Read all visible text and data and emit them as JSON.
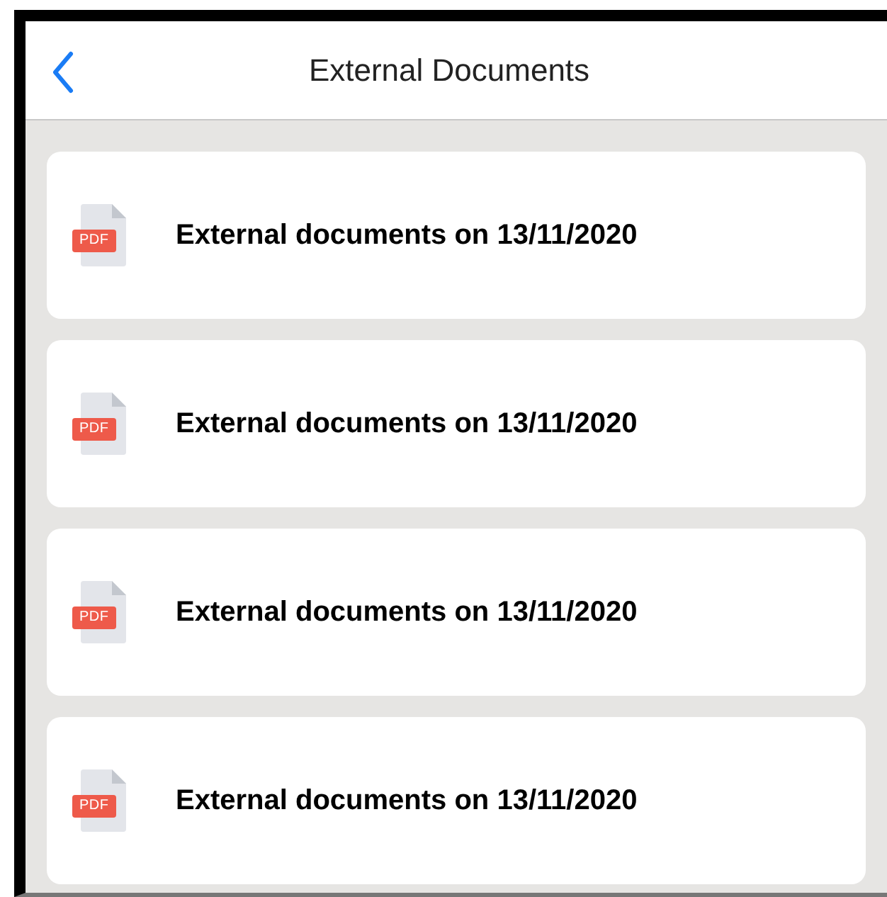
{
  "header": {
    "title": "External Documents"
  },
  "documents": [
    {
      "badge": "PDF",
      "title": "External documents on 13/11/2020"
    },
    {
      "badge": "PDF",
      "title": "External documents on 13/11/2020"
    },
    {
      "badge": "PDF",
      "title": "External documents on 13/11/2020"
    },
    {
      "badge": "PDF",
      "title": "External documents on 13/11/2020"
    }
  ]
}
